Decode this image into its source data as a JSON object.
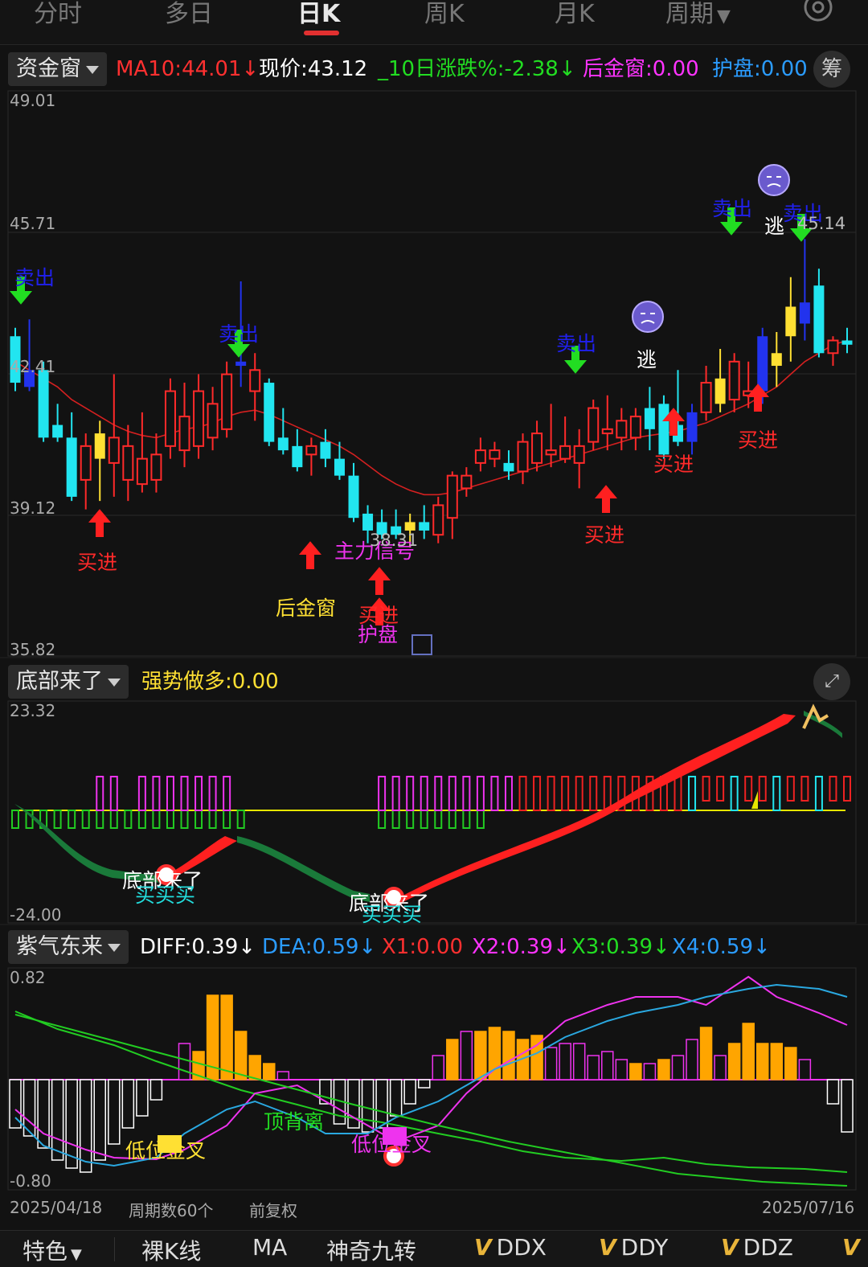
{
  "top_tabs": [
    "分时",
    "多日",
    "日K",
    "周K",
    "月K",
    "周期"
  ],
  "active_tab": "日K",
  "panel1": {
    "indicator": "资金窗",
    "values": [
      {
        "text": "MA10:44.01↓",
        "color": "#ff3030"
      },
      {
        "text": "现价:43.12",
        "color": "#ffffff"
      },
      {
        "text": "_10日涨跌%:-2.38↓",
        "color": "#22dd22"
      },
      {
        "text": "后金窗:0.00",
        "color": "#ff33ff"
      },
      {
        "text": "护盘:0.00",
        "color": "#2b9cff"
      }
    ],
    "right_button": "筹",
    "y_labels": [
      "49.01",
      "45.71",
      "42.41",
      "39.12",
      "35.82"
    ],
    "signals": {
      "sell": "卖出",
      "buy": "买进",
      "escape": "逃",
      "main_signal": "主力信号",
      "after_gold": "后金窗",
      "guard": "护盘",
      "low_price": "38.31",
      "high_price": "45.14"
    }
  },
  "panel2": {
    "indicator": "底部来了",
    "values": [
      {
        "text": "强势做多:0.00",
        "color": "#ffe033"
      }
    ],
    "y_labels": [
      "23.32",
      "-24.00"
    ],
    "labels": {
      "bottom": "底部来了",
      "buy3": "买买买"
    }
  },
  "panel3": {
    "indicator": "紫气东来",
    "values": [
      {
        "text": "DIFF:0.39↓",
        "color": "#ffffff"
      },
      {
        "text": "DEA:0.59↓",
        "color": "#2b9cff"
      },
      {
        "text": "X1:0.00",
        "color": "#ff3030"
      },
      {
        "text": "X2:0.39↓",
        "color": "#ff33ff"
      },
      {
        "text": "X3:0.39↓",
        "color": "#22dd22"
      },
      {
        "text": "X4:0.59↓",
        "color": "#2b9cff"
      }
    ],
    "y_labels": [
      "0.82",
      "-0.80"
    ],
    "labels": {
      "top_divergence": "顶背离",
      "low_golden_cross": "低位金叉"
    }
  },
  "footer": {
    "start_date": "2025/04/18",
    "period": "周期数60个",
    "adjust": "前复权",
    "end_date": "2025/07/16"
  },
  "bottom_tabs": [
    "特色",
    "裸K线",
    "MA",
    "神奇九转",
    "DDX",
    "DDY",
    "DDZ",
    "V"
  ],
  "chart_data": {
    "type": "candlestick",
    "period_count": 60,
    "x_range": [
      "2025/04/18",
      "2025/07/16"
    ],
    "price_ylim": [
      35.82,
      49.01
    ],
    "candles": [
      {
        "o": 43.2,
        "h": 43.4,
        "l": 41.9,
        "c": 42.1
      },
      {
        "o": 42.4,
        "h": 43.6,
        "l": 41.9,
        "c": 42.0
      },
      {
        "o": 42.4,
        "h": 42.6,
        "l": 40.7,
        "c": 40.8
      },
      {
        "o": 41.1,
        "h": 41.6,
        "l": 40.7,
        "c": 40.8
      },
      {
        "o": 40.8,
        "h": 41.4,
        "l": 39.3,
        "c": 39.4
      },
      {
        "o": 39.8,
        "h": 40.9,
        "l": 39.1,
        "c": 40.6
      },
      {
        "o": 40.3,
        "h": 41.2,
        "l": 39.3,
        "c": 40.9
      },
      {
        "o": 40.2,
        "h": 42.3,
        "l": 39.4,
        "c": 40.8
      },
      {
        "o": 39.8,
        "h": 41.1,
        "l": 39.3,
        "c": 40.6
      },
      {
        "o": 39.7,
        "h": 41.4,
        "l": 39.5,
        "c": 40.3
      },
      {
        "o": 39.8,
        "h": 40.9,
        "l": 39.5,
        "c": 40.4
      },
      {
        "o": 40.6,
        "h": 42.2,
        "l": 40.3,
        "c": 41.9
      },
      {
        "o": 40.5,
        "h": 42.1,
        "l": 40.1,
        "c": 41.3
      },
      {
        "o": 40.6,
        "h": 42.3,
        "l": 40.3,
        "c": 41.9
      },
      {
        "o": 40.8,
        "h": 42.0,
        "l": 40.5,
        "c": 41.6
      },
      {
        "o": 41.0,
        "h": 42.6,
        "l": 40.8,
        "c": 42.3
      },
      {
        "o": 42.5,
        "h": 44.5,
        "l": 42.0,
        "c": 42.6
      },
      {
        "o": 41.9,
        "h": 42.8,
        "l": 41.2,
        "c": 42.4
      },
      {
        "o": 42.1,
        "h": 42.2,
        "l": 40.6,
        "c": 40.7
      },
      {
        "o": 40.8,
        "h": 41.5,
        "l": 40.4,
        "c": 40.5
      },
      {
        "o": 40.6,
        "h": 41.0,
        "l": 40.0,
        "c": 40.1
      },
      {
        "o": 40.4,
        "h": 40.8,
        "l": 39.9,
        "c": 40.6
      },
      {
        "o": 40.7,
        "h": 41.0,
        "l": 40.1,
        "c": 40.3
      },
      {
        "o": 40.3,
        "h": 40.7,
        "l": 39.8,
        "c": 39.9
      },
      {
        "o": 39.9,
        "h": 40.2,
        "l": 38.8,
        "c": 38.9
      },
      {
        "o": 39.0,
        "h": 39.2,
        "l": 38.3,
        "c": 38.6
      },
      {
        "o": 38.8,
        "h": 39.1,
        "l": 38.4,
        "c": 38.5
      },
      {
        "o": 38.7,
        "h": 39.1,
        "l": 38.4,
        "c": 38.5
      },
      {
        "o": 38.8,
        "h": 39.0,
        "l": 38.2,
        "c": 38.6
      },
      {
        "o": 38.8,
        "h": 39.2,
        "l": 38.4,
        "c": 38.6
      },
      {
        "o": 38.5,
        "h": 39.4,
        "l": 38.3,
        "c": 39.2
      },
      {
        "o": 38.9,
        "h": 40.0,
        "l": 38.4,
        "c": 39.9
      },
      {
        "o": 39.6,
        "h": 40.1,
        "l": 39.4,
        "c": 39.9
      },
      {
        "o": 40.2,
        "h": 40.8,
        "l": 40.0,
        "c": 40.5
      },
      {
        "o": 40.3,
        "h": 40.7,
        "l": 40.1,
        "c": 40.5
      },
      {
        "o": 40.2,
        "h": 40.5,
        "l": 39.8,
        "c": 40.0
      },
      {
        "o": 40.0,
        "h": 40.9,
        "l": 39.7,
        "c": 40.7
      },
      {
        "o": 40.2,
        "h": 41.2,
        "l": 40.0,
        "c": 40.9
      },
      {
        "o": 40.4,
        "h": 41.6,
        "l": 40.1,
        "c": 40.5
      },
      {
        "o": 40.3,
        "h": 41.3,
        "l": 40.2,
        "c": 40.6
      },
      {
        "o": 40.2,
        "h": 41.0,
        "l": 39.6,
        "c": 40.6
      },
      {
        "o": 40.7,
        "h": 41.7,
        "l": 40.5,
        "c": 41.5
      },
      {
        "o": 40.9,
        "h": 41.8,
        "l": 40.5,
        "c": 41.0
      },
      {
        "o": 40.8,
        "h": 41.5,
        "l": 40.5,
        "c": 41.2
      },
      {
        "o": 40.8,
        "h": 41.5,
        "l": 40.5,
        "c": 41.3
      },
      {
        "o": 41.5,
        "h": 42.0,
        "l": 40.5,
        "c": 41.0
      },
      {
        "o": 41.6,
        "h": 41.8,
        "l": 40.3,
        "c": 40.4
      },
      {
        "o": 41.1,
        "h": 42.4,
        "l": 40.6,
        "c": 40.7
      },
      {
        "o": 40.7,
        "h": 41.6,
        "l": 40.4,
        "c": 41.4
      },
      {
        "o": 41.4,
        "h": 42.5,
        "l": 41.2,
        "c": 42.1
      },
      {
        "o": 41.6,
        "h": 42.9,
        "l": 41.4,
        "c": 42.2
      },
      {
        "o": 41.7,
        "h": 42.8,
        "l": 41.4,
        "c": 42.6
      },
      {
        "o": 41.8,
        "h": 42.6,
        "l": 41.5,
        "c": 41.9
      },
      {
        "o": 41.9,
        "h": 43.4,
        "l": 41.6,
        "c": 43.2
      },
      {
        "o": 42.5,
        "h": 43.3,
        "l": 42.0,
        "c": 42.8
      },
      {
        "o": 43.2,
        "h": 44.6,
        "l": 42.6,
        "c": 43.9
      },
      {
        "o": 43.5,
        "h": 45.5,
        "l": 43.1,
        "c": 44.0
      },
      {
        "o": 44.4,
        "h": 44.8,
        "l": 42.7,
        "c": 42.8
      },
      {
        "o": 42.8,
        "h": 43.2,
        "l": 42.5,
        "c": 43.1
      },
      {
        "o": 43.1,
        "h": 43.4,
        "l": 42.8,
        "c": 43.0
      }
    ],
    "ma10": [
      42.6,
      42.4,
      42.2,
      42.0,
      41.7,
      41.5,
      41.3,
      41.1,
      40.95,
      40.85,
      40.8,
      40.9,
      41.0,
      41.05,
      41.15,
      41.3,
      41.4,
      41.45,
      41.35,
      41.2,
      41.05,
      40.9,
      40.75,
      40.6,
      40.4,
      40.15,
      39.9,
      39.7,
      39.55,
      39.45,
      39.45,
      39.5,
      39.6,
      39.7,
      39.8,
      39.9,
      40.0,
      40.1,
      40.2,
      40.3,
      40.4,
      40.5,
      40.6,
      40.7,
      40.8,
      40.85,
      40.9,
      40.95,
      41.05,
      41.15,
      41.3,
      41.45,
      41.6,
      41.8,
      42.0,
      42.3,
      42.6,
      42.8,
      43.0,
      43.1
    ]
  }
}
